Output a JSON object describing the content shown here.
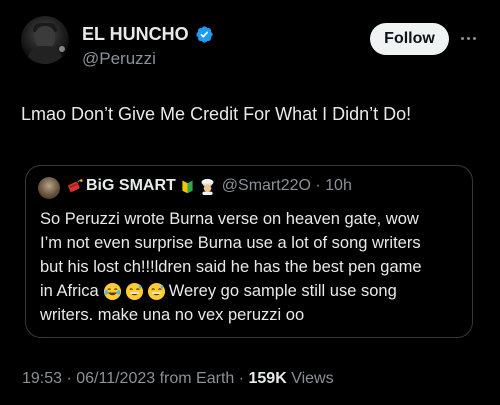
{
  "author": {
    "display_name": "EL HUNCHO",
    "handle": "@Peruzzi",
    "verified_icon": "verified-badge-icon",
    "avatar_icon": "profile-photo"
  },
  "actions": {
    "follow_label": "Follow",
    "more_icon": "more-options-icon"
  },
  "tweet": {
    "text": "Lmao Don’t Give Me Credit For What I Didn’t Do!"
  },
  "quoted_tweet": {
    "display_name": "BiG SMART",
    "name_emojis": [
      "dynamite-emoji",
      "beginner-symbol-emoji",
      "chef-emoji"
    ],
    "handle_time": "@Smart22O · 10h",
    "text_lines": [
      "So Peruzzi wrote Burna verse on heaven gate, wow",
      "I’m not even surprise Burna use a lot of song writers",
      "but his lost ch!!!ldren said he has the best pen game",
      "in Africa",
      " Werey go sample still use song",
      "writers. make una no vex peruzzi oo"
    ],
    "inline_emojis": [
      "crying-laughing-emoji",
      "grinning-sweat-emoji",
      "grinning-sweat-emoji"
    ]
  },
  "meta": {
    "time_date": "19:53 · 06/11/2023 from Earth · ",
    "views_count": "159K",
    "views_label": " Views"
  },
  "colors": {
    "background": "#000000",
    "text": "#e7e9ea",
    "secondary_text": "#8b9199",
    "verified_blue": "#1d9bf0",
    "follow_bg": "#eff3f4",
    "border": "#33383c"
  }
}
